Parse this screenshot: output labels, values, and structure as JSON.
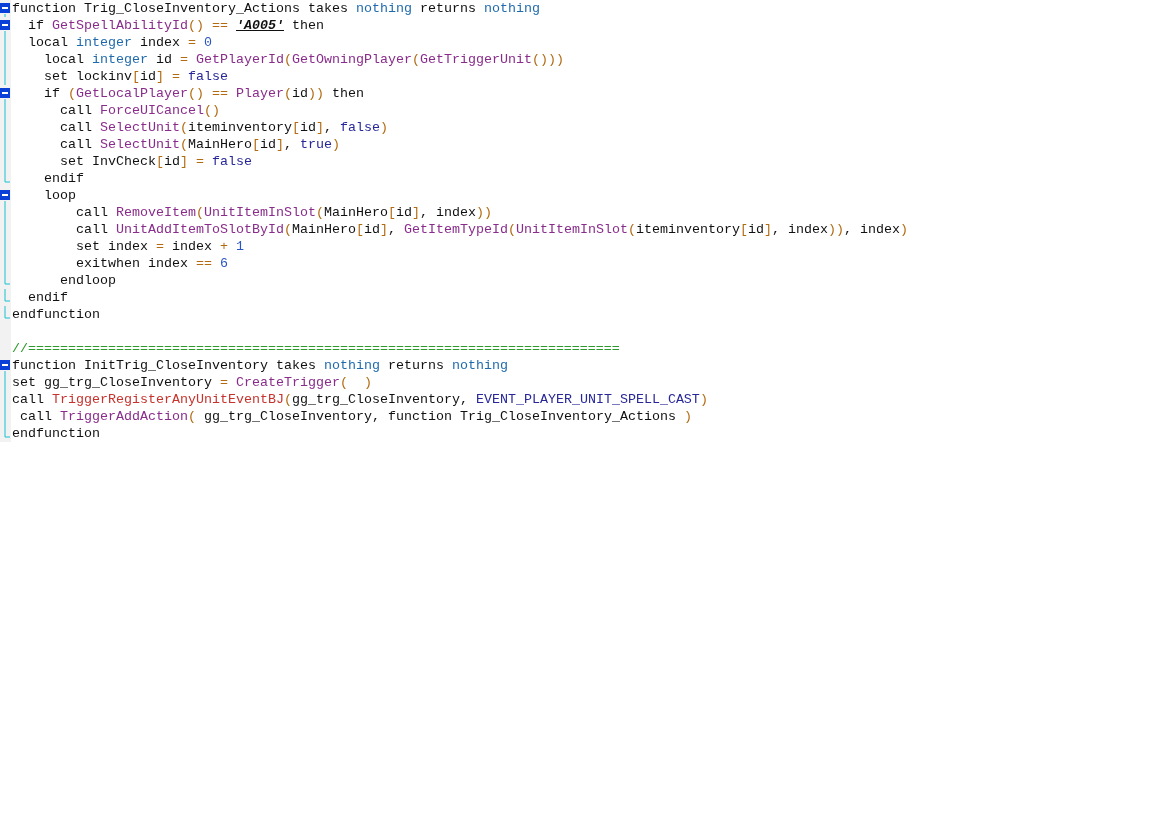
{
  "editor": {
    "lines": [
      {
        "kind": "fold_start",
        "tokens": [
          {
            "kind": "plain",
            "text": "function Trig_CloseInventory_Actions takes "
          },
          {
            "kind": "type",
            "text": "nothing"
          },
          {
            "kind": "plain",
            "text": " returns "
          },
          {
            "kind": "type",
            "text": "nothing"
          }
        ]
      },
      {
        "kind": "fold_start",
        "tokens": [
          {
            "kind": "plain",
            "text": "  if "
          },
          {
            "kind": "func",
            "text": "GetSpellAbilityId"
          },
          {
            "kind": "punct",
            "text": "() == "
          },
          {
            "kind": "string",
            "text": "'A005'"
          },
          {
            "kind": "plain",
            "text": " then"
          }
        ]
      },
      {
        "kind": "fold_body",
        "tokens": [
          {
            "kind": "plain",
            "text": "  local "
          },
          {
            "kind": "type",
            "text": "integer"
          },
          {
            "kind": "plain",
            "text": " index "
          },
          {
            "kind": "punct",
            "text": "= "
          },
          {
            "kind": "number",
            "text": "0"
          }
        ]
      },
      {
        "kind": "fold_body",
        "tokens": [
          {
            "kind": "plain",
            "text": "    local "
          },
          {
            "kind": "type",
            "text": "integer"
          },
          {
            "kind": "plain",
            "text": " id "
          },
          {
            "kind": "punct",
            "text": "= "
          },
          {
            "kind": "func",
            "text": "GetPlayerId"
          },
          {
            "kind": "punct",
            "text": "("
          },
          {
            "kind": "func",
            "text": "GetOwningPlayer"
          },
          {
            "kind": "punct",
            "text": "("
          },
          {
            "kind": "func",
            "text": "GetTriggerUnit"
          },
          {
            "kind": "punct",
            "text": "()))"
          }
        ]
      },
      {
        "kind": "fold_body",
        "tokens": [
          {
            "kind": "plain",
            "text": "    set lockinv"
          },
          {
            "kind": "punct",
            "text": "["
          },
          {
            "kind": "plain",
            "text": "id"
          },
          {
            "kind": "punct",
            "text": "] = "
          },
          {
            "kind": "constant",
            "text": "false"
          }
        ]
      },
      {
        "kind": "fold_start",
        "tokens": [
          {
            "kind": "plain",
            "text": "    if "
          },
          {
            "kind": "punct",
            "text": "("
          },
          {
            "kind": "func",
            "text": "GetLocalPlayer"
          },
          {
            "kind": "punct",
            "text": "() == "
          },
          {
            "kind": "func",
            "text": "Player"
          },
          {
            "kind": "punct",
            "text": "("
          },
          {
            "kind": "plain",
            "text": "id"
          },
          {
            "kind": "punct",
            "text": "))"
          },
          {
            "kind": "plain",
            "text": " then"
          }
        ]
      },
      {
        "kind": "fold_body",
        "tokens": [
          {
            "kind": "plain",
            "text": "      call "
          },
          {
            "kind": "func",
            "text": "ForceUICancel"
          },
          {
            "kind": "punct",
            "text": "()"
          }
        ]
      },
      {
        "kind": "fold_body",
        "tokens": [
          {
            "kind": "plain",
            "text": "      call "
          },
          {
            "kind": "func",
            "text": "SelectUnit"
          },
          {
            "kind": "punct",
            "text": "("
          },
          {
            "kind": "plain",
            "text": "iteminventory"
          },
          {
            "kind": "punct",
            "text": "["
          },
          {
            "kind": "plain",
            "text": "id"
          },
          {
            "kind": "punct",
            "text": "]"
          },
          {
            "kind": "plain",
            "text": ", "
          },
          {
            "kind": "constant",
            "text": "false"
          },
          {
            "kind": "punct",
            "text": ")"
          }
        ]
      },
      {
        "kind": "fold_body",
        "tokens": [
          {
            "kind": "plain",
            "text": "      call "
          },
          {
            "kind": "func",
            "text": "SelectUnit"
          },
          {
            "kind": "punct",
            "text": "("
          },
          {
            "kind": "plain",
            "text": "MainHero"
          },
          {
            "kind": "punct",
            "text": "["
          },
          {
            "kind": "plain",
            "text": "id"
          },
          {
            "kind": "punct",
            "text": "]"
          },
          {
            "kind": "plain",
            "text": ", "
          },
          {
            "kind": "constant",
            "text": "true"
          },
          {
            "kind": "punct",
            "text": ")"
          }
        ]
      },
      {
        "kind": "fold_body",
        "tokens": [
          {
            "kind": "plain",
            "text": "      set InvCheck"
          },
          {
            "kind": "punct",
            "text": "["
          },
          {
            "kind": "plain",
            "text": "id"
          },
          {
            "kind": "punct",
            "text": "] = "
          },
          {
            "kind": "constant",
            "text": "false"
          }
        ]
      },
      {
        "kind": "fold_end",
        "tokens": [
          {
            "kind": "plain",
            "text": "    endif"
          }
        ]
      },
      {
        "kind": "fold_start",
        "tokens": [
          {
            "kind": "plain",
            "text": "    loop"
          }
        ]
      },
      {
        "kind": "fold_body",
        "tokens": [
          {
            "kind": "plain",
            "text": "        call "
          },
          {
            "kind": "func",
            "text": "RemoveItem"
          },
          {
            "kind": "punct",
            "text": "("
          },
          {
            "kind": "func",
            "text": "UnitItemInSlot"
          },
          {
            "kind": "punct",
            "text": "("
          },
          {
            "kind": "plain",
            "text": "MainHero"
          },
          {
            "kind": "punct",
            "text": "["
          },
          {
            "kind": "plain",
            "text": "id"
          },
          {
            "kind": "punct",
            "text": "]"
          },
          {
            "kind": "plain",
            "text": ", index"
          },
          {
            "kind": "punct",
            "text": "))"
          }
        ]
      },
      {
        "kind": "fold_body",
        "tokens": [
          {
            "kind": "plain",
            "text": "        call "
          },
          {
            "kind": "func",
            "text": "UnitAddItemToSlotById"
          },
          {
            "kind": "punct",
            "text": "("
          },
          {
            "kind": "plain",
            "text": "MainHero"
          },
          {
            "kind": "punct",
            "text": "["
          },
          {
            "kind": "plain",
            "text": "id"
          },
          {
            "kind": "punct",
            "text": "]"
          },
          {
            "kind": "plain",
            "text": ", "
          },
          {
            "kind": "func",
            "text": "GetItemTypeId"
          },
          {
            "kind": "punct",
            "text": "("
          },
          {
            "kind": "func",
            "text": "UnitItemInSlot"
          },
          {
            "kind": "punct",
            "text": "("
          },
          {
            "kind": "plain",
            "text": "iteminventory"
          },
          {
            "kind": "punct",
            "text": "["
          },
          {
            "kind": "plain",
            "text": "id"
          },
          {
            "kind": "punct",
            "text": "]"
          },
          {
            "kind": "plain",
            "text": ", index"
          },
          {
            "kind": "punct",
            "text": "))"
          },
          {
            "kind": "plain",
            "text": ", index"
          },
          {
            "kind": "punct",
            "text": ")"
          }
        ]
      },
      {
        "kind": "fold_body",
        "tokens": [
          {
            "kind": "plain",
            "text": "        set index "
          },
          {
            "kind": "punct",
            "text": "="
          },
          {
            "kind": "plain",
            "text": " index "
          },
          {
            "kind": "punct",
            "text": "+ "
          },
          {
            "kind": "number",
            "text": "1"
          }
        ]
      },
      {
        "kind": "fold_body",
        "tokens": [
          {
            "kind": "plain",
            "text": "        exitwhen index "
          },
          {
            "kind": "punct",
            "text": "== "
          },
          {
            "kind": "number",
            "text": "6"
          }
        ]
      },
      {
        "kind": "fold_end",
        "tokens": [
          {
            "kind": "plain",
            "text": "      endloop"
          }
        ]
      },
      {
        "kind": "fold_end",
        "tokens": [
          {
            "kind": "plain",
            "text": "  endif"
          }
        ]
      },
      {
        "kind": "fold_end",
        "tokens": [
          {
            "kind": "plain",
            "text": "endfunction"
          }
        ]
      },
      {
        "kind": "blank"
      },
      {
        "kind": "plain",
        "tokens": [
          {
            "kind": "comment",
            "text": "//=========================================================================="
          }
        ]
      },
      {
        "kind": "fold_start",
        "tokens": [
          {
            "kind": "plain",
            "text": "function InitTrig_CloseInventory takes "
          },
          {
            "kind": "type",
            "text": "nothing"
          },
          {
            "kind": "plain",
            "text": " returns "
          },
          {
            "kind": "type",
            "text": "nothing"
          }
        ]
      },
      {
        "kind": "fold_body",
        "tokens": [
          {
            "kind": "plain",
            "text": "set gg_trg_CloseInventory "
          },
          {
            "kind": "punct",
            "text": "= "
          },
          {
            "kind": "func",
            "text": "CreateTrigger"
          },
          {
            "kind": "punct",
            "text": "(  )"
          }
        ]
      },
      {
        "kind": "fold_body",
        "tokens": [
          {
            "kind": "plain",
            "text": "call "
          },
          {
            "kind": "native",
            "text": "TriggerRegisterAnyUnitEventBJ"
          },
          {
            "kind": "punct",
            "text": "("
          },
          {
            "kind": "plain",
            "text": "gg_trg_CloseInventory, "
          },
          {
            "kind": "constant",
            "text": "EVENT_PLAYER_UNIT_SPELL_CAST"
          },
          {
            "kind": "punct",
            "text": ")"
          }
        ]
      },
      {
        "kind": "fold_body",
        "tokens": [
          {
            "kind": "plain",
            "text": " call "
          },
          {
            "kind": "func",
            "text": "TriggerAddAction"
          },
          {
            "kind": "punct",
            "text": "("
          },
          {
            "kind": "plain",
            "text": " gg_trg_CloseInventory, function Trig_CloseInventory_Actions "
          },
          {
            "kind": "punct",
            "text": ")"
          }
        ]
      },
      {
        "kind": "fold_end",
        "tokens": [
          {
            "kind": "plain",
            "text": "endfunction"
          }
        ]
      }
    ]
  }
}
